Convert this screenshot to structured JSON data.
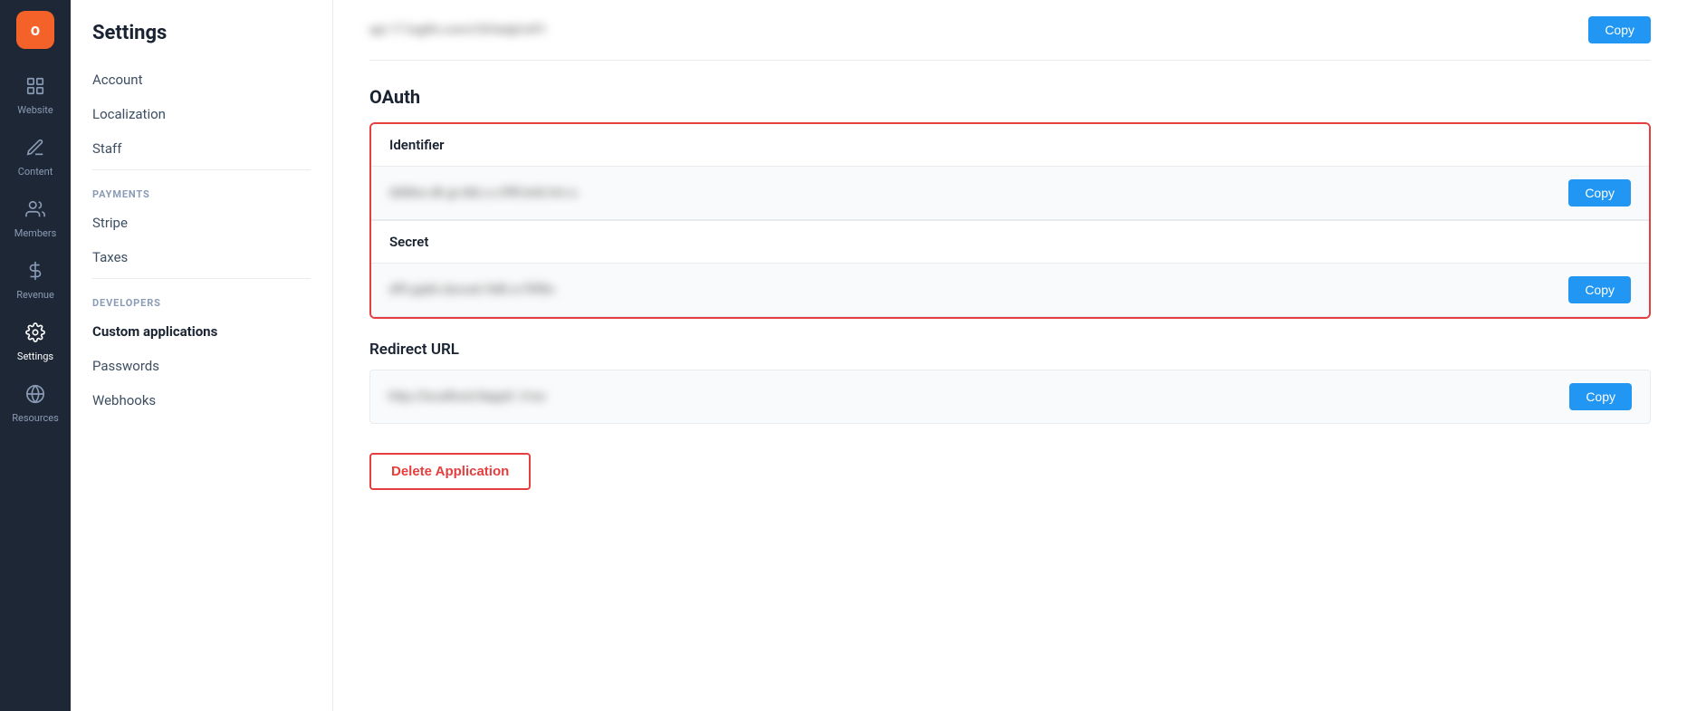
{
  "app": {
    "logo_letter": "o"
  },
  "icon_nav": {
    "items": [
      {
        "id": "website",
        "label": "Website",
        "icon": "⊞",
        "active": false
      },
      {
        "id": "content",
        "label": "Content",
        "icon": "✏",
        "active": false
      },
      {
        "id": "members",
        "label": "Members",
        "icon": "👥",
        "active": false
      },
      {
        "id": "revenue",
        "label": "Revenue",
        "icon": "📊",
        "active": false
      },
      {
        "id": "settings",
        "label": "Settings",
        "icon": "⚙",
        "active": true
      },
      {
        "id": "resources",
        "label": "Resources",
        "icon": "🌐",
        "active": false
      }
    ]
  },
  "settings_sidebar": {
    "title": "Settings",
    "general": {
      "items": [
        {
          "id": "account",
          "label": "Account",
          "active": false
        },
        {
          "id": "localization",
          "label": "Localization",
          "active": false
        },
        {
          "id": "staff",
          "label": "Staff",
          "active": false
        }
      ]
    },
    "payments_section": "PAYMENTS",
    "payments": {
      "items": [
        {
          "id": "stripe",
          "label": "Stripe",
          "active": false
        },
        {
          "id": "taxes",
          "label": "Taxes",
          "active": false
        }
      ]
    },
    "developers_section": "DEVELOPERS",
    "developers": {
      "items": [
        {
          "id": "custom-applications",
          "label": "Custom applications",
          "active": true
        },
        {
          "id": "passwords",
          "label": "Passwords",
          "active": false
        },
        {
          "id": "webhooks",
          "label": "Webhooks",
          "active": false
        }
      ]
    }
  },
  "main": {
    "top_blurred_value": "api.17.logthr.com/l/8/kalpl/e91",
    "copy_top_label": "Copy",
    "oauth_section_title": "OAuth",
    "identifier_label": "Identifier",
    "identifier_value": "dddlss.dk.gr.dds.s.c9f8.bnb.hm.s.",
    "identifier_copy_label": "Copy",
    "secret_label": "Secret",
    "secret_value": "df9.ppbh.docoet.9d8.cr.f9f8n.",
    "secret_copy_label": "Copy",
    "redirect_url_title": "Redirect URL",
    "redirect_url_value": "http://localhost:8app0. l/roc",
    "redirect_copy_label": "Copy",
    "delete_button_label": "Delete Application"
  }
}
